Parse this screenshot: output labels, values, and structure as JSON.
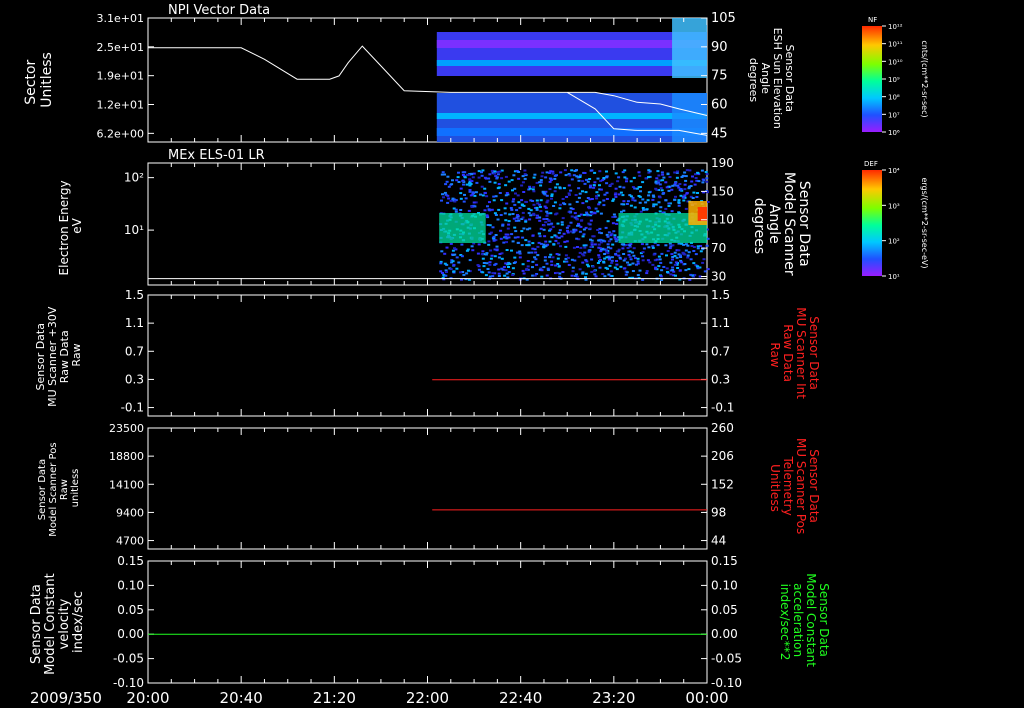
{
  "colors": {
    "background": "#000000",
    "axis": "#ffffff",
    "trace_white": "#ffffff",
    "trace_red": "#ff2020",
    "trace_green": "#20ff20",
    "label_red": "#ff2020",
    "label_green": "#20ff20"
  },
  "time_axis": {
    "date_label": "2009/350",
    "tick_labels": [
      "20:00",
      "20:40",
      "21:20",
      "22:00",
      "22:40",
      "23:20",
      "00:00"
    ],
    "range_minutes": [
      0,
      240
    ]
  },
  "colorbars": [
    {
      "name": "NF",
      "tick_labels": [
        "10¹²",
        "10¹¹",
        "10¹⁰",
        "10⁹",
        "10⁸",
        "10⁷",
        "10⁶"
      ],
      "unit_label": "cnts/(cm**2-sr-sec)"
    },
    {
      "name": "DEF",
      "tick_labels": [
        "10⁴",
        "10³",
        "10²",
        "10¹"
      ],
      "unit_label": "ergs/(cm**2-sr-sec-eV)"
    }
  ],
  "chart_data": [
    {
      "type": "line",
      "title": "NPI Vector Data",
      "left_axis": {
        "label_lines": [
          "Sector",
          "Unitless"
        ],
        "tick_labels": [
          "3.1e+01",
          "2.5e+01",
          "1.9e+01",
          "1.2e+01",
          "6.2e+00"
        ],
        "range": [
          0,
          31
        ]
      },
      "right_axis": {
        "label_lines": [
          "Sensor Data",
          "ESH Sun Elevation",
          "Angle",
          "degrees"
        ],
        "tick_labels": [
          "105",
          "90",
          "75",
          "60",
          "45"
        ],
        "range": [
          30,
          105
        ]
      },
      "series": [
        {
          "axis": "right",
          "x": [
            0,
            28,
            40,
            50,
            64,
            72,
            78,
            82,
            86,
            92,
            100,
            110,
            130,
            150,
            170,
            180,
            185,
            192,
            200,
            210,
            220,
            228,
            240
          ],
          "y": [
            87,
            87,
            87,
            80,
            68,
            68,
            68,
            70,
            78,
            88,
            76,
            61,
            60,
            60,
            60,
            60,
            60,
            60,
            58,
            54,
            53,
            50,
            46
          ]
        },
        {
          "axis": "right",
          "x": [
            180,
            192,
            200,
            210,
            220,
            228,
            236,
            240
          ],
          "y": [
            60,
            50,
            38,
            37,
            37,
            37,
            35,
            34
          ]
        }
      ],
      "spectrogram": {
        "start_minute": 124,
        "end_minute": 240
      }
    },
    {
      "type": "heatmap",
      "title": "MEx ELS-01 LR",
      "left_axis": {
        "label_lines": [
          "Electron Energy",
          "eV"
        ],
        "tick_labels": [
          "10²",
          "10¹"
        ],
        "range": [
          1,
          300
        ],
        "scale": "log"
      },
      "right_axis": {
        "label_lines": [
          "Sensor Data",
          "Model Scanner",
          "Angle",
          "degrees"
        ],
        "tick_labels": [
          "190",
          "150",
          "110",
          "70",
          "30"
        ],
        "range": [
          0,
          190
        ]
      },
      "series": [
        {
          "axis": "right",
          "x": [
            0,
            240
          ],
          "y": [
            10,
            10
          ]
        }
      ],
      "spectrogram": {
        "start_minute": 125,
        "end_minute": 240
      }
    },
    {
      "type": "line",
      "title": "",
      "left_axis": {
        "label_lines": [
          "Sensor Data",
          "MU Scanner +30V",
          "Raw Data",
          "Raw"
        ],
        "tick_labels": [
          "1.5",
          "1.1",
          "0.7",
          "0.3",
          "-0.1"
        ],
        "range": [
          -0.5,
          1.5
        ]
      },
      "right_axis": {
        "label_lines": [
          "Sensor Data",
          "MU Scanner Int",
          "Raw Data",
          "Raw"
        ],
        "tick_labels": [
          "1.5",
          "1.1",
          "0.7",
          "0.3",
          "-0.1"
        ],
        "range": [
          -0.5,
          1.5
        ],
        "color": "red"
      },
      "series": [
        {
          "axis": "left",
          "color": "red",
          "x": [
            122,
            240
          ],
          "y": [
            0.1,
            0.1
          ]
        }
      ]
    },
    {
      "type": "line",
      "title": "",
      "left_axis": {
        "label_lines": [
          "Sensor Data",
          "Model Scanner Pos",
          "Raw",
          "unitless"
        ],
        "tick_labels": [
          "23500",
          "18800",
          "14100",
          "9400",
          "4700"
        ],
        "range": [
          0,
          23500
        ]
      },
      "right_axis": {
        "label_lines": [
          "Sensor Data",
          "MU Scanner Pos",
          "Telemetry",
          "Unitless"
        ],
        "tick_labels": [
          "260",
          "206",
          "152",
          "98",
          "44"
        ],
        "range": [
          0,
          260
        ],
        "color": "red"
      },
      "series": [
        {
          "axis": "left",
          "color": "red",
          "x": [
            122,
            240
          ],
          "y": [
            7600,
            7600
          ]
        }
      ]
    },
    {
      "type": "line",
      "title": "",
      "left_axis": {
        "label_lines": [
          "Sensor Data",
          "Model Constant",
          "velocity",
          "index/sec"
        ],
        "tick_labels": [
          "0.15",
          "0.10",
          "0.05",
          "0.00",
          "-0.05",
          "-0.10"
        ],
        "range": [
          -0.1,
          0.15
        ]
      },
      "right_axis": {
        "label_lines": [
          "Sensor Data",
          "Model Constant",
          "acceleration",
          "index/sec**2"
        ],
        "tick_labels": [
          "0.15",
          "0.10",
          "0.05",
          "0.00",
          "-0.05",
          "-0.10"
        ],
        "range": [
          -0.1,
          0.15
        ],
        "color": "green"
      },
      "series": [
        {
          "axis": "left",
          "color": "green",
          "x": [
            0,
            240
          ],
          "y": [
            0,
            0
          ]
        }
      ]
    }
  ]
}
